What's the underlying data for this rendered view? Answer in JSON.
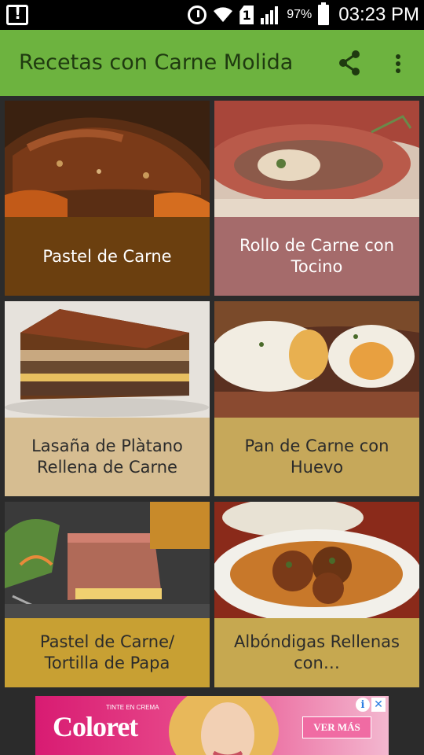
{
  "status_bar": {
    "battery_percent": "97%",
    "time": "03:23 PM",
    "sim_label": "1",
    "icons": [
      "notification-icon",
      "alarm-icon",
      "wifi-icon",
      "sim-icon",
      "signal-icon",
      "battery-icon"
    ]
  },
  "app_bar": {
    "title": "Recetas con Carne Molida",
    "color": "#6db33f",
    "actions": [
      "share-icon",
      "more-vert-icon"
    ]
  },
  "recipes": [
    {
      "label": "Pastel de Carne",
      "label_color": "#6b3f0f",
      "text_color": "#ffffff"
    },
    {
      "label": "Rollo de Carne con Tocino",
      "label_color": "#a56b6b",
      "text_color": "#ffffff"
    },
    {
      "label": "Lasaña de Plàtano Rellena de Carne",
      "label_color": "#d6bd91",
      "text_color": "#2b2b2b"
    },
    {
      "label": "Pan de Carne con Huevo",
      "label_color": "#c6a85a",
      "text_color": "#2b2b2b"
    },
    {
      "label": "Pastel de Carne/ Tortilla de Papa",
      "label_color": "#c8a033",
      "text_color": "#2b2b2b"
    },
    {
      "label": "Albóndigas Rellenas con…",
      "label_color": "#c6a850",
      "text_color": "#2b2b2b"
    }
  ],
  "ad": {
    "brand": "Coloret",
    "tagline": "TINTE EN CREMA",
    "cta": "VER MÁS",
    "info_glyph": "i",
    "close_glyph": "✕"
  }
}
